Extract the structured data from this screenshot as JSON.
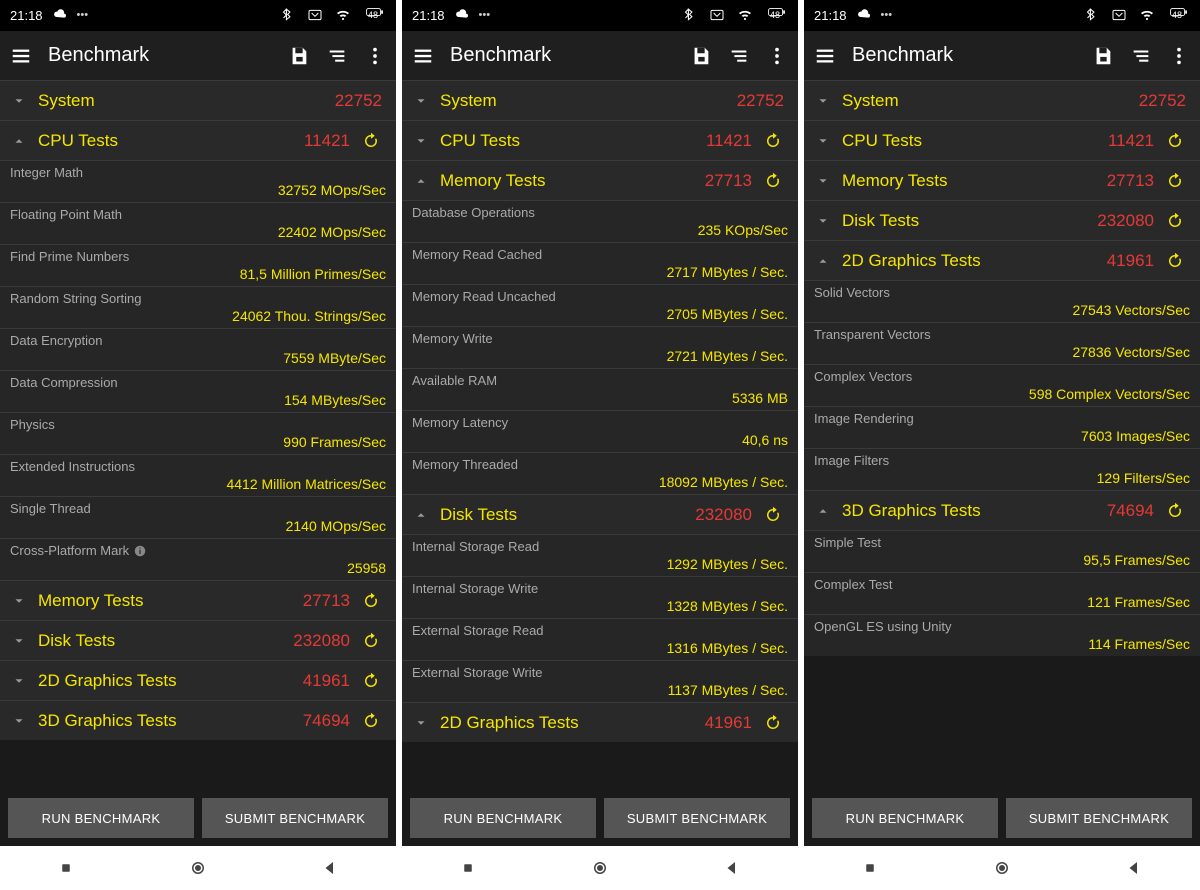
{
  "status": {
    "time": "21:18",
    "battery": "48"
  },
  "buttons": {
    "run": "RUN BENCHMARK",
    "submit": "SUBMIT BENCHMARK"
  },
  "appbar": {
    "title": "Benchmark"
  },
  "panes": [
    {
      "rows": [
        {
          "t": "item",
          "chev": "d",
          "name": "System",
          "score": "22752",
          "refresh": false
        },
        {
          "t": "item",
          "chev": "u",
          "name": "CPU Tests",
          "score": "11421",
          "refresh": true
        },
        {
          "t": "sub",
          "lbl": "Integer Math",
          "val": "32752 MOps/Sec"
        },
        {
          "t": "sub",
          "lbl": "Floating Point Math",
          "val": "22402 MOps/Sec"
        },
        {
          "t": "sub",
          "lbl": "Find Prime Numbers",
          "val": "81,5 Million Primes/Sec"
        },
        {
          "t": "sub",
          "lbl": "Random String Sorting",
          "val": "24062 Thou. Strings/Sec"
        },
        {
          "t": "sub",
          "lbl": "Data Encryption",
          "val": "7559 MByte/Sec"
        },
        {
          "t": "sub",
          "lbl": "Data Compression",
          "val": "154 MBytes/Sec"
        },
        {
          "t": "sub",
          "lbl": "Physics",
          "val": "990 Frames/Sec"
        },
        {
          "t": "sub",
          "lbl": "Extended Instructions",
          "val": "4412 Million Matrices/Sec"
        },
        {
          "t": "sub",
          "lbl": "Single Thread",
          "val": "2140 MOps/Sec"
        },
        {
          "t": "sub",
          "lbl": "Cross-Platform Mark",
          "val": "25958",
          "info": true
        },
        {
          "t": "item",
          "chev": "d",
          "name": "Memory Tests",
          "score": "27713",
          "refresh": true
        },
        {
          "t": "item",
          "chev": "d",
          "name": "Disk Tests",
          "score": "232080",
          "refresh": true
        },
        {
          "t": "item",
          "chev": "d",
          "name": "2D Graphics Tests",
          "score": "41961",
          "refresh": true
        },
        {
          "t": "item",
          "chev": "d",
          "name": "3D Graphics Tests",
          "score": "74694",
          "refresh": true
        }
      ]
    },
    {
      "rows": [
        {
          "t": "item",
          "chev": "d",
          "name": "System",
          "score": "22752",
          "refresh": false
        },
        {
          "t": "item",
          "chev": "d",
          "name": "CPU Tests",
          "score": "11421",
          "refresh": true
        },
        {
          "t": "item",
          "chev": "u",
          "name": "Memory Tests",
          "score": "27713",
          "refresh": true
        },
        {
          "t": "sub",
          "lbl": "Database Operations",
          "val": "235 KOps/Sec"
        },
        {
          "t": "sub",
          "lbl": "Memory Read Cached",
          "val": "2717 MBytes / Sec."
        },
        {
          "t": "sub",
          "lbl": "Memory Read Uncached",
          "val": "2705 MBytes / Sec."
        },
        {
          "t": "sub",
          "lbl": "Memory Write",
          "val": "2721 MBytes / Sec."
        },
        {
          "t": "sub",
          "lbl": "Available RAM",
          "val": "5336 MB"
        },
        {
          "t": "sub",
          "lbl": "Memory Latency",
          "val": "40,6 ns"
        },
        {
          "t": "sub",
          "lbl": "Memory Threaded",
          "val": "18092 MBytes / Sec."
        },
        {
          "t": "item",
          "chev": "u",
          "name": "Disk Tests",
          "score": "232080",
          "refresh": true
        },
        {
          "t": "sub",
          "lbl": "Internal Storage Read",
          "val": "1292 MBytes / Sec."
        },
        {
          "t": "sub",
          "lbl": "Internal Storage Write",
          "val": "1328 MBytes / Sec."
        },
        {
          "t": "sub",
          "lbl": "External Storage Read",
          "val": "1316 MBytes / Sec."
        },
        {
          "t": "sub",
          "lbl": "External Storage Write",
          "val": "1137 MBytes / Sec."
        },
        {
          "t": "item",
          "chev": "d",
          "name": "2D Graphics Tests",
          "score": "41961",
          "refresh": true
        }
      ]
    },
    {
      "rows": [
        {
          "t": "item",
          "chev": "d",
          "name": "System",
          "score": "22752",
          "refresh": false
        },
        {
          "t": "item",
          "chev": "d",
          "name": "CPU Tests",
          "score": "11421",
          "refresh": true
        },
        {
          "t": "item",
          "chev": "d",
          "name": "Memory Tests",
          "score": "27713",
          "refresh": true
        },
        {
          "t": "item",
          "chev": "d",
          "name": "Disk Tests",
          "score": "232080",
          "refresh": true
        },
        {
          "t": "item",
          "chev": "u",
          "name": "2D Graphics Tests",
          "score": "41961",
          "refresh": true
        },
        {
          "t": "sub",
          "lbl": "Solid Vectors",
          "val": "27543 Vectors/Sec"
        },
        {
          "t": "sub",
          "lbl": "Transparent Vectors",
          "val": "27836 Vectors/Sec"
        },
        {
          "t": "sub",
          "lbl": "Complex Vectors",
          "val": "598 Complex Vectors/Sec"
        },
        {
          "t": "sub",
          "lbl": "Image Rendering",
          "val": "7603 Images/Sec"
        },
        {
          "t": "sub",
          "lbl": "Image Filters",
          "val": "129 Filters/Sec"
        },
        {
          "t": "item",
          "chev": "u",
          "name": "3D Graphics Tests",
          "score": "74694",
          "refresh": true
        },
        {
          "t": "sub",
          "lbl": "Simple Test",
          "val": "95,5 Frames/Sec"
        },
        {
          "t": "sub",
          "lbl": "Complex Test",
          "val": "121 Frames/Sec"
        },
        {
          "t": "sub",
          "lbl": "OpenGL ES using Unity",
          "val": "114 Frames/Sec"
        }
      ]
    }
  ]
}
